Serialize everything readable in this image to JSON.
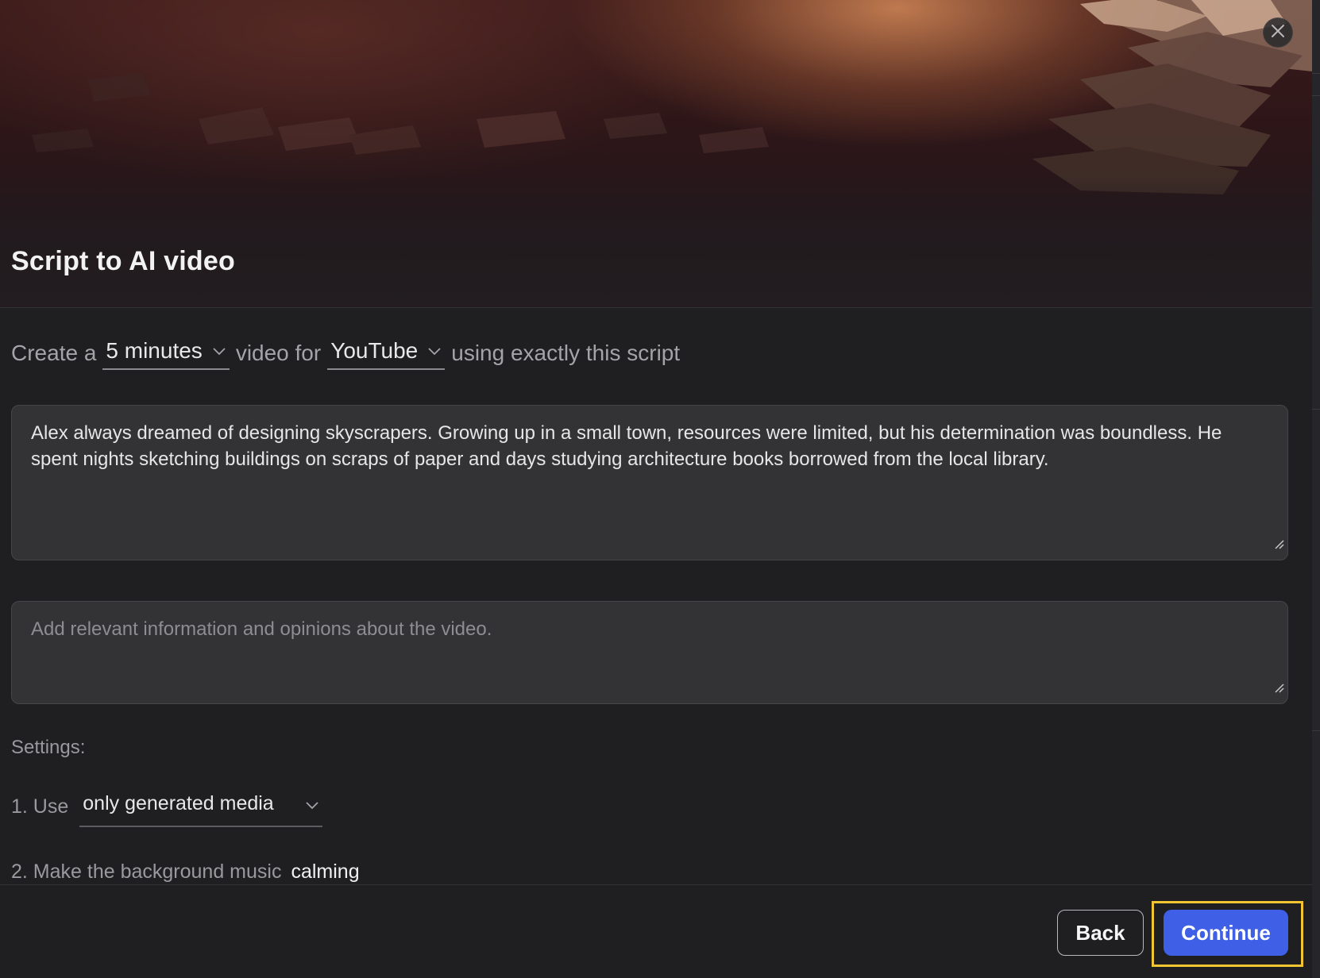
{
  "dialog": {
    "title": "Script to AI video",
    "close_icon": "close-icon"
  },
  "prompt": {
    "prefix": "Create a",
    "duration": "5 minutes",
    "middle": "video for",
    "platform": "YouTube",
    "suffix": "using exactly this script"
  },
  "script_text": "Alex always dreamed of designing skyscrapers. Growing up in a small town, resources were limited, but his determination was boundless. He spent nights sketching buildings on scraps of paper and days studying architecture books borrowed from the local library.",
  "info_input": {
    "value": "",
    "placeholder": "Add relevant information and opinions about the video."
  },
  "settings": {
    "label": "Settings:",
    "media_prefix": "1. Use",
    "media_value": "only generated media",
    "music_prefix": "2. Make the background music",
    "music_value": "calming"
  },
  "footer": {
    "back_label": "Back",
    "continue_label": "Continue"
  },
  "colors": {
    "accent": "#3e5fe6",
    "highlight": "#f0c432",
    "background": "#1f1f21",
    "field": "#333335"
  }
}
